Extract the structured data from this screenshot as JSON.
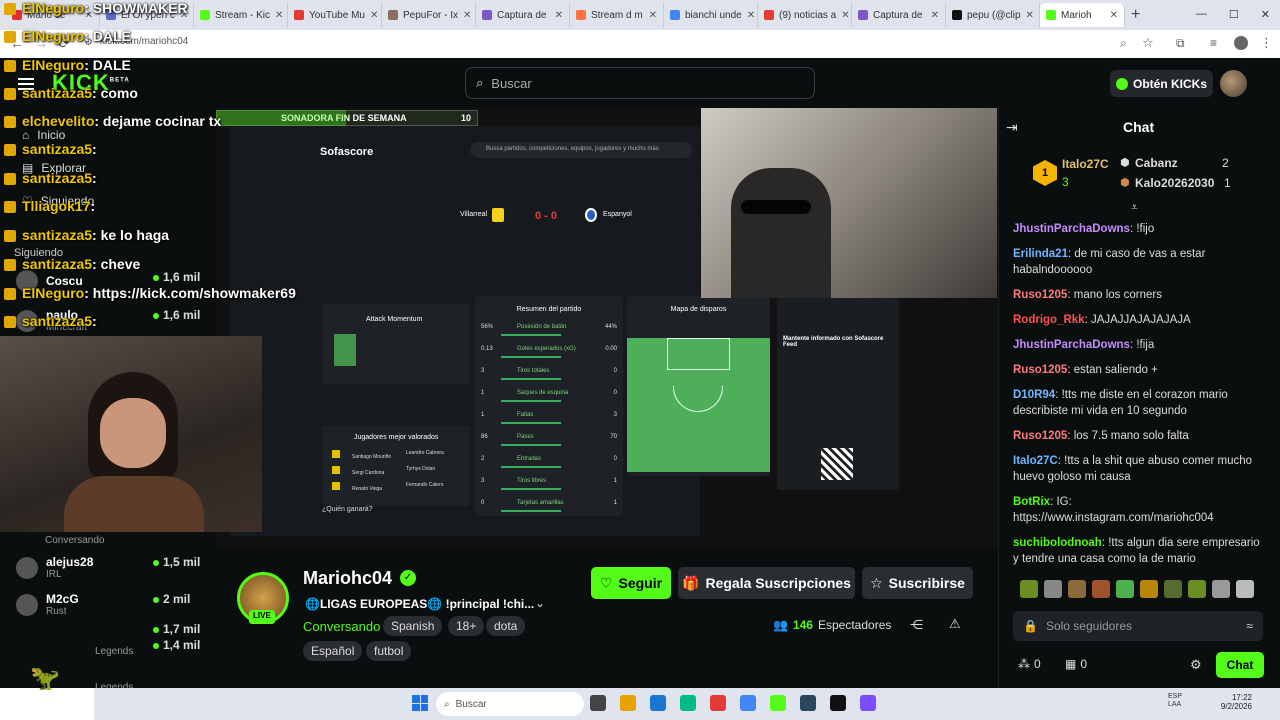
{
  "browser": {
    "tabs": [
      {
        "label": "Mario ce",
        "color": "#e03030"
      },
      {
        "label": "El Ol ypen c",
        "color": "#5c6bc0"
      },
      {
        "label": "Stream - Kic",
        "color": "#53fc18"
      },
      {
        "label": "YouTube Mu",
        "color": "#e53935"
      },
      {
        "label": "PepuFor - Ix",
        "color": "#8d6e63"
      },
      {
        "label": "Captura de",
        "color": "#7e57c2"
      },
      {
        "label": "Stream d m",
        "color": "#ff7043"
      },
      {
        "label": "bianchi unde",
        "color": "#4285f4"
      },
      {
        "label": "(9) noticias a",
        "color": "#e53935"
      },
      {
        "label": "Captura de",
        "color": "#7e57c2"
      },
      {
        "label": "pepu (@clip",
        "color": "#111111"
      },
      {
        "label": "Marioh",
        "color": "#53fc18"
      }
    ],
    "url": "kick.com/mariohc04"
  },
  "header": {
    "search_placeholder": "Buscar",
    "get_kicks_label": "Obtén KICKs",
    "logo": "KICK",
    "logo_badge": "BETA"
  },
  "sidebar": {
    "inicio": "Inicio",
    "explorar": "Explorar",
    "siguiendo": "Siguiendo",
    "siguiendo2": "Siguiendo",
    "channels": [
      {
        "name": "Coscu",
        "game": "",
        "viewers": "1,6 mil"
      },
      {
        "name": "paulo",
        "game": "Minecraft",
        "viewers": "1,6 mil"
      },
      {
        "name": "",
        "game": "Conversando",
        "viewers": ""
      },
      {
        "name": "alejus28",
        "game": "IRL",
        "viewers": "1,5 mil"
      },
      {
        "name": "M2cG",
        "game": "Rust",
        "viewers": "2 mil"
      },
      {
        "name": "",
        "game": "",
        "viewers": "1,7 mil"
      },
      {
        "name": "",
        "game": "Legends",
        "viewers": "1,4 mil"
      },
      {
        "name": "",
        "game": "Legends",
        "viewers": ""
      }
    ]
  },
  "overlay_chat": [
    {
      "user": "ElNeguro",
      "msg": ": SHOWMAKER"
    },
    {
      "user": "ElNeguro",
      "msg": ": DALE"
    },
    {
      "user": "ElNeguro",
      "msg": ": DALE"
    },
    {
      "user": "santizaza5",
      "msg": ": como"
    },
    {
      "user": "elchevelito",
      "msg": ": dejame cocinar tx"
    },
    {
      "user": "santizaza5",
      "msg": ":"
    },
    {
      "user": "santizaza5",
      "msg": ":"
    },
    {
      "user": "Tlliagok17",
      "msg": ":"
    },
    {
      "user": "santizaza5",
      "msg": ": ke lo haga"
    },
    {
      "user": "santizaza5",
      "msg": ": cheve"
    },
    {
      "user": "ElNeguro",
      "msg": ": https://kick.com/showmaker69"
    },
    {
      "user": "santizaza5",
      "msg": ":"
    }
  ],
  "stream_overlay": {
    "banner": "SONADORA FIN DE SEMANA",
    "banner_num": "10",
    "site": "Sofascore",
    "search": "Busca partidos, competiciones, equipos, jugadores y mucho más",
    "match_home": "Villarreal",
    "match_away": "Espanyol",
    "score": "0 - 0",
    "section_left": "Attack Momentum",
    "section_players": "Jugadores mejor valorados",
    "section_summary": "Resumen del partido",
    "section_shots": "Mapa de disparos",
    "stats": [
      {
        "label": "Posesión de balón",
        "home": "56%",
        "away": "44%"
      },
      {
        "label": "Goles esperados (xG)",
        "home": "0.13",
        "away": "0.00"
      },
      {
        "label": "Tiros totales",
        "home": "3",
        "away": "0"
      },
      {
        "label": "Saques de esquina",
        "home": "1",
        "away": "0"
      },
      {
        "label": "Faltas",
        "home": "1",
        "away": "3"
      },
      {
        "label": "Pases",
        "home": "86",
        "away": "70"
      },
      {
        "label": "Entradas",
        "home": "2",
        "away": "0"
      },
      {
        "label": "Tiros libres",
        "home": "3",
        "away": "1"
      },
      {
        "label": "Tarjetas amarillas",
        "home": "0",
        "away": "1"
      }
    ],
    "players": [
      "Santiago Mouriño",
      "Sergi Cardona",
      "Renato Veiga"
    ],
    "players_right": [
      "Leandro Cabrera",
      "Tyrhys Dolan",
      "Fernando Calero"
    ],
    "promo_title": "Mantente informado con Sofascore Feed",
    "quien": "¿Quién ganará?"
  },
  "channel": {
    "name": "Mariohc04",
    "title": "🌐LIGAS EUROPEAS🌐 !principal !chi...",
    "category": "Conversando",
    "tags": [
      "Spanish",
      "18+",
      "dota",
      "Español",
      "futbol"
    ],
    "live_badge": "LIVE",
    "viewers": "146",
    "viewers_label": "Espectadores",
    "follow_label": "Seguir",
    "gift_label": "Regala Suscripciones",
    "subscribe_label": "Suscribirse"
  },
  "chat": {
    "title": "Chat",
    "leaders": [
      {
        "name": "Italo27C",
        "count": "3"
      },
      {
        "name": "Cabanz",
        "count": "2"
      },
      {
        "name": "Kalo20262030",
        "count": "1"
      }
    ],
    "messages": [
      {
        "user": "JhustinParchaDowns",
        "color": "#c58cff",
        "text": "!fijo"
      },
      {
        "user": "Erilinda21",
        "color": "#6fb7ff",
        "text": "de mi caso de vas a estar habalndoooooo"
      },
      {
        "user": "Ruso1205",
        "color": "#ff7a7a",
        "text": "mano los corners"
      },
      {
        "user": "Rodrigo_Rkk",
        "color": "#ff5050",
        "text": "JAJAJJAJAJAJAJA"
      },
      {
        "user": "JhustinParchaDowns",
        "color": "#c58cff",
        "text": "!fija"
      },
      {
        "user": "Ruso1205",
        "color": "#ff7a7a",
        "text": "estan saliendo +"
      },
      {
        "user": "D10R94",
        "color": "#6fb7ff",
        "text": "!tts me diste en el corazon mario describiste mi vida en 10 segundo"
      },
      {
        "user": "Ruso1205",
        "color": "#ff7a7a",
        "text": "los 7.5 mano solo falta"
      },
      {
        "user": "Italo27C",
        "color": "#6fb7ff",
        "text": "!tts a la shit que abuso comer mucho huevo goloso mi causa"
      },
      {
        "user": "BotRix",
        "color": "#53fc18",
        "text": "IG: https://www.instagram.com/mariohc004"
      },
      {
        "user": "suchibolodnoah",
        "color": "#53fc18",
        "text": "!tts algun dia sere empresario y tendre una casa como la de mario"
      }
    ],
    "input_placeholder": "Solo seguidores",
    "send_label": "Chat",
    "kicks_count": "0",
    "gift_count": "0"
  },
  "taskbar": {
    "search_placeholder": "Buscar",
    "time": "17:22",
    "date": "9/2/2026",
    "lang": "ESP LAA"
  }
}
